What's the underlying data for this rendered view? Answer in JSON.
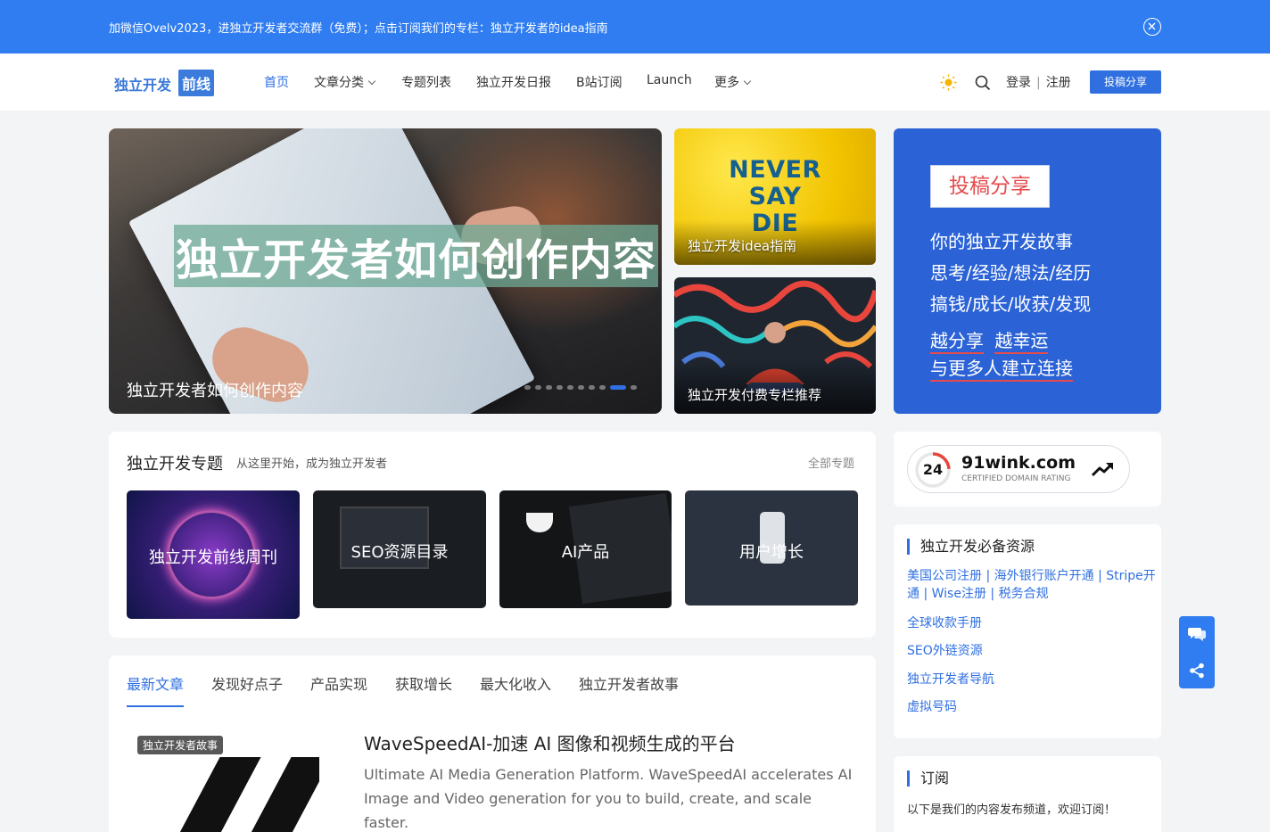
{
  "announcement": {
    "text": "加微信Ovelv2023，进独立开发者交流群（免费）；点击订阅我们的专栏：独立开发者的idea指南"
  },
  "header": {
    "logo_part1": "独立开发",
    "logo_part2": "前线",
    "nav": [
      "首页",
      "文章分类",
      "专题列表",
      "独立开发日报",
      "B站订阅",
      "Launch",
      "更多"
    ],
    "login": "登录",
    "register": "注册",
    "submit": "投稿分享"
  },
  "hero": {
    "big_title": "独立开发者如何创作内容",
    "caption": "独立开发者如何创作内容",
    "slide_count": 10,
    "active_slide": 8
  },
  "side_cards": [
    {
      "art_text": [
        "NEVER",
        "SAY",
        "DIE"
      ],
      "caption": "独立开发idea指南"
    },
    {
      "caption": "独立开发付费专栏推荐"
    }
  ],
  "promo": {
    "tag": "投稿分享",
    "lines": [
      "你的独立开发故事",
      "思考/经验/想法/经历",
      "搞钱/成长/收获/发现"
    ],
    "underline1_a": "越分享",
    "underline1_b": "越幸运",
    "underline2": "与更多人建立连接"
  },
  "topics": {
    "title": "独立开发专题",
    "subtitle": "从这里开始，成为独立开发者",
    "all": "全部专题",
    "items": [
      "独立开发前线周刊",
      "SEO资源目录",
      "AI产品",
      "用户增长"
    ]
  },
  "articles": {
    "tabs": [
      "最新文章",
      "发现好点子",
      "产品实现",
      "获取增长",
      "最大化收入",
      "独立开发者故事"
    ],
    "first": {
      "badge": "独立开发者故事",
      "title": "WaveSpeedAI-加速 AI 图像和视频生成的平台",
      "desc": "Ultimate AI Media Generation Platform. WaveSpeedAI accelerates AI Image and Video generation for you to build, create, and scale faster."
    }
  },
  "rating": {
    "score": "24",
    "domain": "91wink.com",
    "label": "CERTIFIED DOMAIN RATING"
  },
  "resources": {
    "title": "独立开发必备资源",
    "multiline": "美国公司注册 | 海外银行账户开通 | Stripe开通 | Wise注册 | 税务合规",
    "links": [
      "全球收款手册",
      "SEO外链资源",
      "独立开发者导航",
      "虚拟号码"
    ]
  },
  "subscribe": {
    "title": "订阅",
    "text": "以下是我们的内容发布频道，欢迎订阅！"
  },
  "colors": {
    "accent": "#2f6fe0",
    "announce_bg": "#2f7df0",
    "promo_bg": "#2b63d6",
    "highlight_red": "#e54b4b"
  },
  "icons": [
    "close-icon",
    "chevron-down-icon",
    "sun-icon",
    "search-icon",
    "trending-up-icon",
    "chat-icon",
    "share-icon"
  ]
}
